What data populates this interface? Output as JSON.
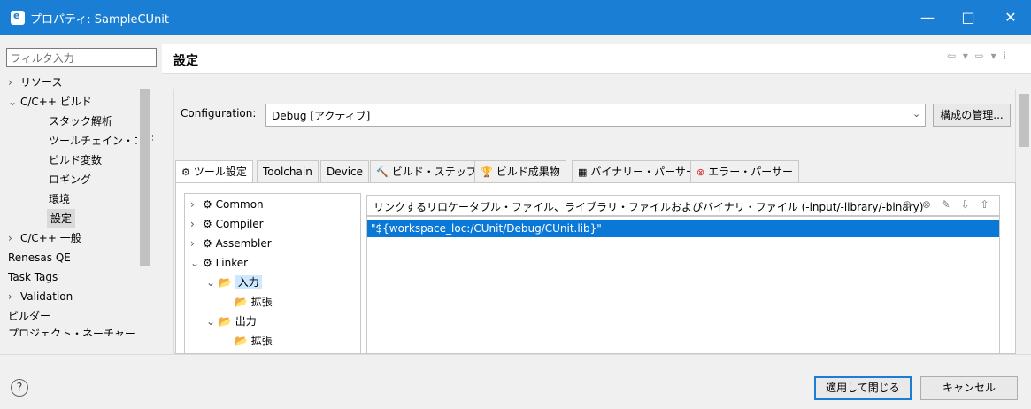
{
  "window": {
    "title": "プロパティ: SampleCUnit",
    "min_icon": "—",
    "max_icon": "□",
    "close_icon": "✕",
    "app_icon_letter": "e"
  },
  "filter": {
    "placeholder": "フィルタ入力"
  },
  "sidebar": {
    "items": [
      {
        "label": "リソース",
        "chevron": "›"
      },
      {
        "label": "C/C++ ビルド",
        "chevron": "⌄"
      },
      {
        "label": "スタック解析",
        "chevron": ""
      },
      {
        "label": "ツールチェイン・エデ",
        "chevron": ""
      },
      {
        "label": "ビルド変数",
        "chevron": ""
      },
      {
        "label": "ロギング",
        "chevron": ""
      },
      {
        "label": "環境",
        "chevron": ""
      },
      {
        "label": "設定",
        "chevron": ""
      },
      {
        "label": "C/C++ 一般",
        "chevron": "›"
      },
      {
        "label": "Renesas QE",
        "chevron": ""
      },
      {
        "label": "Task Tags",
        "chevron": ""
      },
      {
        "label": "Validation",
        "chevron": "›"
      },
      {
        "label": "ビルダー",
        "chevron": ""
      },
      {
        "label": "プロジェクト・ネーチャー",
        "chevron": ""
      }
    ]
  },
  "header": {
    "title": "設定",
    "nav": "⇦ ▾ ⇨ ▾ ⁞"
  },
  "config": {
    "label": "Configuration:",
    "value": "Debug [アクティブ]",
    "chevron": "⌄",
    "manage_button": "構成の管理..."
  },
  "tabs": [
    {
      "label": "ツール設定",
      "icon": "⚙"
    },
    {
      "label": "Toolchain",
      "icon": ""
    },
    {
      "label": "Device",
      "icon": ""
    },
    {
      "label": "ビルド・ステップ",
      "icon": "🔨"
    },
    {
      "label": "ビルド成果物",
      "icon": "🏆"
    },
    {
      "label": "バイナリー・パーサー",
      "icon": "▦"
    },
    {
      "label": "エラー・パーサー",
      "icon": "⊗"
    }
  ],
  "tool_tree": [
    {
      "label": "Common",
      "chevron": "›",
      "icon": "⚙"
    },
    {
      "label": "Compiler",
      "chevron": "›",
      "icon": "⚙"
    },
    {
      "label": "Assembler",
      "chevron": "›",
      "icon": "⚙"
    },
    {
      "label": "Linker",
      "chevron": "⌄",
      "icon": "⚙"
    },
    {
      "label": "入力",
      "chevron": "⌄",
      "icon": "📂"
    },
    {
      "label": "拡張",
      "chevron": "",
      "icon": "📂"
    },
    {
      "label": "出力",
      "chevron": "⌄",
      "icon": "📂"
    },
    {
      "label": "拡張",
      "chevron": "",
      "icon": "📂"
    }
  ],
  "list": {
    "title": "リンクするリロケータブル・ファイル、ライブラリ・ファイルおよびバイナリ・ファイル (-input/-library/-binary)",
    "tools": "⊕ ⊗ ✎ ⇩ ⇧",
    "rows": [
      "\"${workspace_loc:/CUnit/Debug/CUnit.lib}\""
    ]
  },
  "footer": {
    "help": "?",
    "apply": "適用して閉じる",
    "cancel": "キャンセル"
  },
  "colors": {
    "titlebar": "#1a7fd4",
    "selection": "#0a78d7"
  }
}
